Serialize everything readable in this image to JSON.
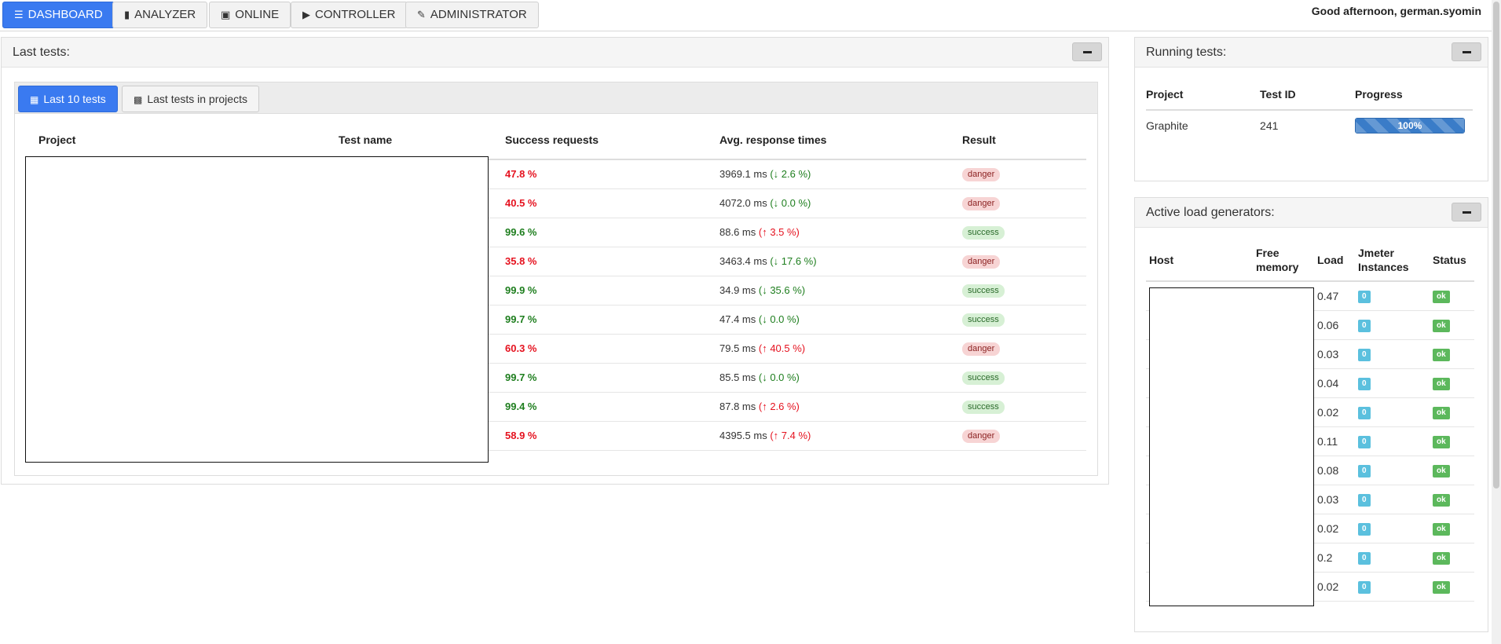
{
  "nav": {
    "tabs": [
      {
        "label": "DASHBOARD",
        "icon": "list-icon",
        "active": true
      },
      {
        "label": "ANALYZER",
        "icon": "bar-chart-icon",
        "active": false
      },
      {
        "label": "ONLINE",
        "icon": "monitor-icon",
        "active": false
      },
      {
        "label": "CONTROLLER",
        "icon": "play-icon",
        "active": false
      },
      {
        "label": "ADMINISTRATOR",
        "icon": "wrench-icon",
        "active": false
      }
    ],
    "greeting": "Good afternoon, german.syomin"
  },
  "last_tests": {
    "title": "Last tests:",
    "tabs": [
      {
        "label": "Last 10 tests",
        "icon": "grid-icon",
        "active": true
      },
      {
        "label": "Last tests in projects",
        "icon": "grid-large-icon",
        "active": false
      }
    ],
    "columns": [
      "Project",
      "Test name",
      "Success requests",
      "Avg. response times",
      "Result"
    ],
    "rows": [
      {
        "success": "47.8 %",
        "success_color": "#e5121f",
        "time": "3969.1 ms",
        "delta": "(↓ 2.6 %)",
        "delta_color": "#1e7e1e",
        "result": "danger"
      },
      {
        "success": "40.5 %",
        "success_color": "#e5121f",
        "time": "4072.0 ms",
        "delta": "(↓ 0.0 %)",
        "delta_color": "#1e7e1e",
        "result": "danger"
      },
      {
        "success": "99.6 %",
        "success_color": "#1e7e1e",
        "time": "88.6 ms",
        "delta": "(↑ 3.5 %)",
        "delta_color": "#e5121f",
        "result": "success"
      },
      {
        "success": "35.8 %",
        "success_color": "#e5121f",
        "time": "3463.4 ms",
        "delta": "(↓ 17.6 %)",
        "delta_color": "#1e7e1e",
        "result": "danger"
      },
      {
        "success": "99.9 %",
        "success_color": "#1e7e1e",
        "time": "34.9 ms",
        "delta": "(↓ 35.6 %)",
        "delta_color": "#1e7e1e",
        "result": "success"
      },
      {
        "success": "99.7 %",
        "success_color": "#1e7e1e",
        "time": "47.4 ms",
        "delta": "(↓ 0.0 %)",
        "delta_color": "#1e7e1e",
        "result": "success"
      },
      {
        "success": "60.3 %",
        "success_color": "#e5121f",
        "time": "79.5 ms",
        "delta": "(↑ 40.5 %)",
        "delta_color": "#e5121f",
        "result": "danger"
      },
      {
        "success": "99.7 %",
        "success_color": "#1e7e1e",
        "time": "85.5 ms",
        "delta": "(↓ 0.0 %)",
        "delta_color": "#1e7e1e",
        "result": "success"
      },
      {
        "success": "99.4 %",
        "success_color": "#1e7e1e",
        "time": "87.8 ms",
        "delta": "(↑ 2.6 %)",
        "delta_color": "#e5121f",
        "result": "success"
      },
      {
        "success": "58.9 %",
        "success_color": "#e5121f",
        "time": "4395.5 ms",
        "delta": "(↑ 7.4 %)",
        "delta_color": "#e5121f",
        "result": "danger"
      }
    ]
  },
  "running_tests": {
    "title": "Running tests:",
    "columns": [
      "Project",
      "Test ID",
      "Progress"
    ],
    "rows": [
      {
        "project": "Graphite",
        "test_id": "241",
        "progress": 100,
        "progress_label": "100%"
      }
    ]
  },
  "load_generators": {
    "title": "Active load generators:",
    "columns": [
      "Host",
      "Free memory",
      "Load",
      "Jmeter Instances",
      "Status"
    ],
    "rows": [
      {
        "load": "0.47",
        "instances": "0",
        "status": "ok"
      },
      {
        "load": "0.06",
        "instances": "0",
        "status": "ok"
      },
      {
        "load": "0.03",
        "instances": "0",
        "status": "ok"
      },
      {
        "load": "0.04",
        "instances": "0",
        "status": "ok"
      },
      {
        "load": "0.02",
        "instances": "0",
        "status": "ok"
      },
      {
        "load": "0.11",
        "instances": "0",
        "status": "ok"
      },
      {
        "load": "0.08",
        "instances": "0",
        "status": "ok"
      },
      {
        "load": "0.03",
        "instances": "0",
        "status": "ok"
      },
      {
        "load": "0.02",
        "instances": "0",
        "status": "ok"
      },
      {
        "load": "0.2",
        "instances": "0",
        "status": "ok"
      },
      {
        "load": "0.02",
        "instances": "0",
        "status": "ok"
      }
    ]
  }
}
